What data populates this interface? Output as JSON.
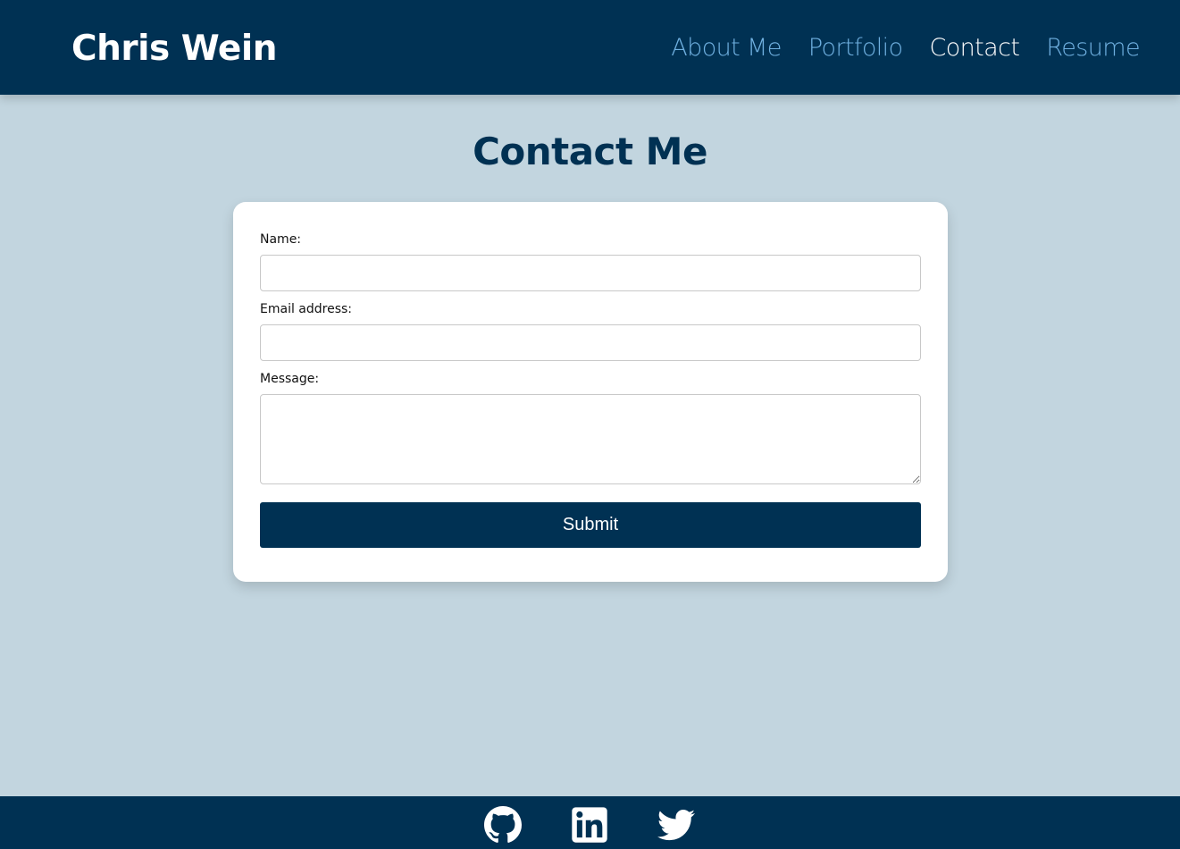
{
  "header": {
    "brand": "Chris Wein",
    "nav": [
      {
        "label": "About Me",
        "active": false
      },
      {
        "label": "Portfolio",
        "active": false
      },
      {
        "label": "Contact",
        "active": true
      },
      {
        "label": "Resume",
        "active": false
      }
    ]
  },
  "main": {
    "title": "Contact Me",
    "form": {
      "name_label": "Name:",
      "name_value": "",
      "email_label": "Email address:",
      "email_value": "",
      "message_label": "Message:",
      "message_value": "",
      "submit_label": "Submit"
    }
  },
  "footer": {
    "icons": [
      "github-icon",
      "linkedin-icon",
      "twitter-icon"
    ]
  },
  "colors": {
    "navy": "#003153",
    "nav_link": "#6fb0e0",
    "background": "#c2d5df",
    "card": "#ffffff"
  }
}
